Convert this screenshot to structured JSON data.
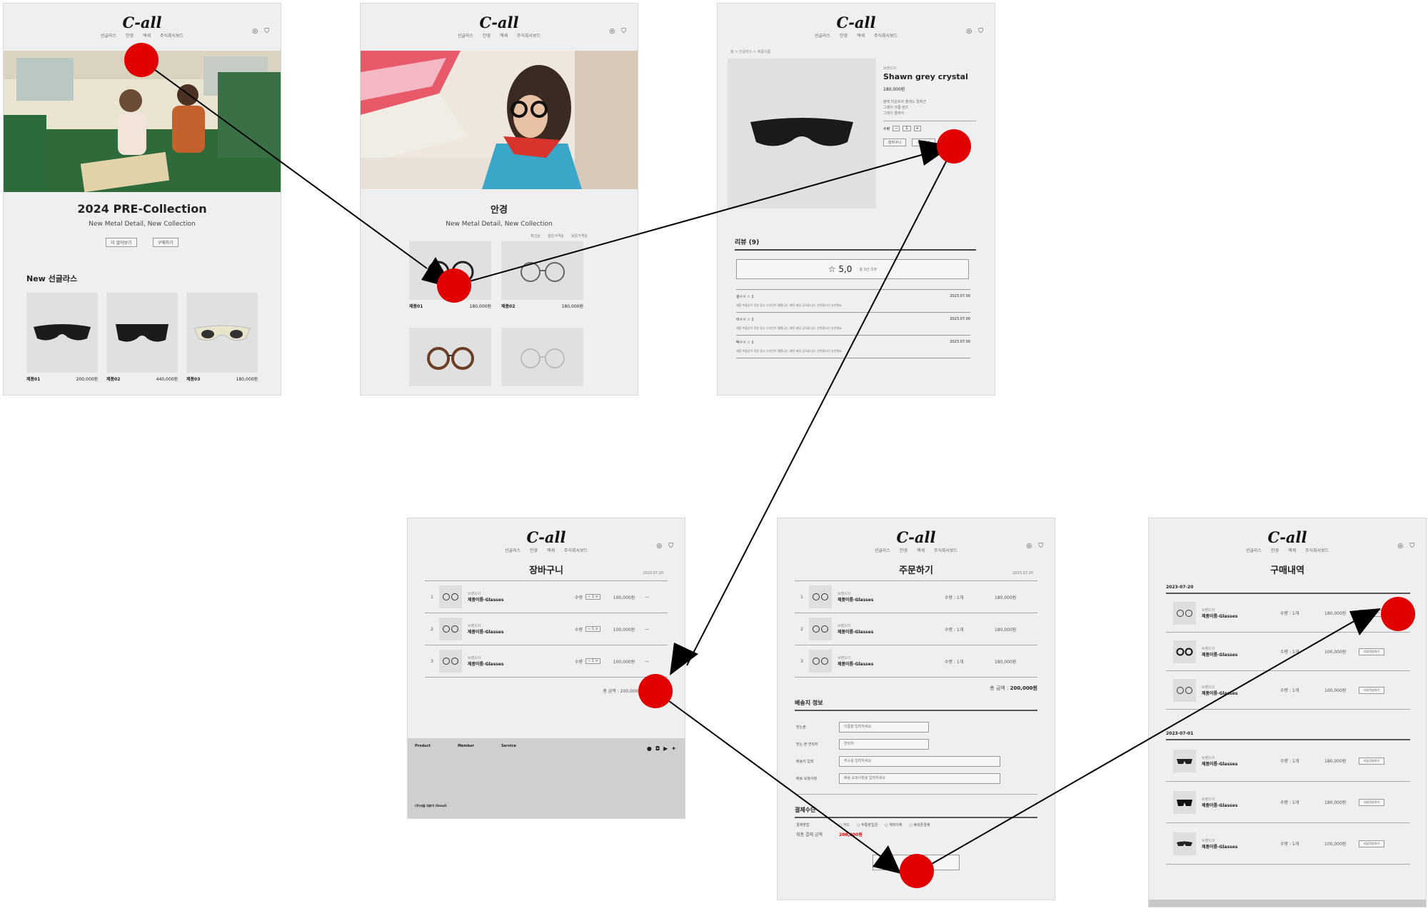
{
  "brand": {
    "logo": "C-all"
  },
  "nav": [
    "선글라스",
    "안경",
    "액세",
    "주식회사보드"
  ],
  "screens": {
    "home": {
      "title": "2024 PRE-Collection",
      "subtitle": "New Metal Detail, New Collection",
      "buttons": [
        "더 알아보기",
        "구매하기"
      ],
      "section_title": "New 선글라스",
      "products": [
        {
          "name": "제품01",
          "price": "200,000원"
        },
        {
          "name": "제품02",
          "price": "440,000원"
        },
        {
          "name": "제품03",
          "price": "180,000원"
        }
      ]
    },
    "glasses": {
      "title": "안경",
      "subtitle": "New Metal Detail, New Collection",
      "sort": [
        "최신순",
        "높은가격순",
        "낮은가격순"
      ],
      "products": [
        {
          "name": "제품01",
          "price": "180,000원"
        },
        {
          "name": "제품02",
          "price": "180,000원"
        }
      ]
    },
    "detail": {
      "breadcrumb": "홈 > 선글라스 > 제품이름",
      "brand_small": "브랜드이",
      "product_name": "Shawn grey crystal",
      "price": "180,000원",
      "desc": [
        "블랙 마운트와 플래드 컬렉션",
        "그레이 크롬 렌즈",
        "그레이 클래식"
      ],
      "qty_label": "수량",
      "qty_value": "1",
      "buttons": [
        "장바구니",
        "구매하기"
      ],
      "review_title": "리뷰 (9)",
      "rating": "☆ 5,0",
      "rating_sub": "총 9건 리뷰",
      "reviews": [
        {
          "user": "김ㅇㅇ ☆ 1",
          "date": "2023.07.00",
          "text": "제품 착용감이 정말 좋고 디자인이 예쁩니다. 빠른 배송 감사합니다. 만족합니다 추천해요."
        },
        {
          "user": "이ㅇㅇ ☆ 1",
          "date": "2023.07.00",
          "text": "제품 착용감이 정말 좋고 디자인이 예쁩니다. 빠른 배송 감사합니다. 만족합니다 추천해요."
        },
        {
          "user": "박ㅇㅇ ☆ 1",
          "date": "2023.07.00",
          "text": "제품 착용감이 정말 좋고 디자인이 예쁩니다. 빠른 배송 감사합니다. 만족합니다 추천해요."
        }
      ]
    },
    "cart": {
      "title": "장바구니",
      "date": "2023.07.20",
      "items": [
        {
          "no": "1",
          "brand": "브랜드이",
          "name": "제품이름-Glasses",
          "qty_label": "수량",
          "price": "100,000원"
        },
        {
          "no": "2",
          "brand": "브랜드이",
          "name": "제품이름-Glasses",
          "qty_label": "수량",
          "price": "100,000원"
        },
        {
          "no": "3",
          "brand": "브랜드이",
          "name": "제품이름-Glasses",
          "qty_label": "수량",
          "price": "100,000원"
        }
      ],
      "total": "총 금액 : 200,000원",
      "footer_cols": [
        "Product",
        "Member",
        "Service"
      ],
      "footer_company": "(주)씨올 대표이 (Seoul)"
    },
    "order": {
      "title": "주문하기",
      "date": "2023.07.20",
      "items": [
        {
          "no": "1",
          "brand": "브랜드이",
          "name": "제품이름-Glasses",
          "qty": "수량 : 1개",
          "price": "180,000원"
        },
        {
          "no": "2",
          "brand": "브랜드이",
          "name": "제품이름-Glasses",
          "qty": "수량 : 1개",
          "price": "180,000원"
        },
        {
          "no": "3",
          "brand": "브랜드이",
          "name": "제품이름-Glasses",
          "qty": "수량 : 1개",
          "price": "180,000원"
        }
      ],
      "total_label": "총 금액 :",
      "total_value": "200,000원",
      "ship_title": "배송지 정보",
      "fields": [
        {
          "label": "받는분",
          "placeholder": "이름을 입력하세요"
        },
        {
          "label": "받는 분 연락처",
          "placeholder": "연락처"
        },
        {
          "label": "배송지 입력",
          "placeholder": "주소를 입력하세요"
        },
        {
          "label": "배송 요청사항",
          "placeholder": "배송 요청사항을 입력하세요"
        }
      ],
      "pay_title": "결제수단",
      "pay_method_label": "결제방법",
      "pay_options": [
        "카드",
        "무통장입금",
        "계좌이체",
        "휴대폰결제"
      ],
      "final_label": "최종 결제 금액",
      "final_value": "200,000원"
    },
    "history": {
      "title": "구매내역",
      "groups": [
        {
          "date": "2023-07-20",
          "items": [
            {
              "brand": "브랜드이",
              "name": "제품이름-Glasses",
              "qty": "수량 : 1개",
              "price": "180,000원",
              "action": "리뷰작성하기"
            },
            {
              "brand": "브랜드이",
              "name": "제품이름-Glasses",
              "qty": "수량 : 1개",
              "price": "100,000원",
              "action": "리뷰작성하기"
            },
            {
              "brand": "브랜드이",
              "name": "제품이름-Glasses",
              "qty": "수량 : 1개",
              "price": "100,000원",
              "action": "리뷰작성하기"
            }
          ]
        },
        {
          "date": "2023-07-01",
          "items": [
            {
              "brand": "브랜드이",
              "name": "제품이름-Glasses",
              "qty": "수량 : 1개",
              "price": "180,000원",
              "action": "리뷰작성하기"
            },
            {
              "brand": "브랜드이",
              "name": "제품이름-Glasses",
              "qty": "수량 : 1개",
              "price": "180,000원",
              "action": "리뷰작성하기"
            },
            {
              "brand": "브랜드이",
              "name": "제품이름-Glasses",
              "qty": "수량 : 1개",
              "price": "100,000원",
              "action": "리뷰작성하기"
            }
          ]
        }
      ]
    }
  },
  "colors": {
    "accent": "#e00000",
    "screen_bg": "#efefef",
    "arrow": "#000000"
  }
}
